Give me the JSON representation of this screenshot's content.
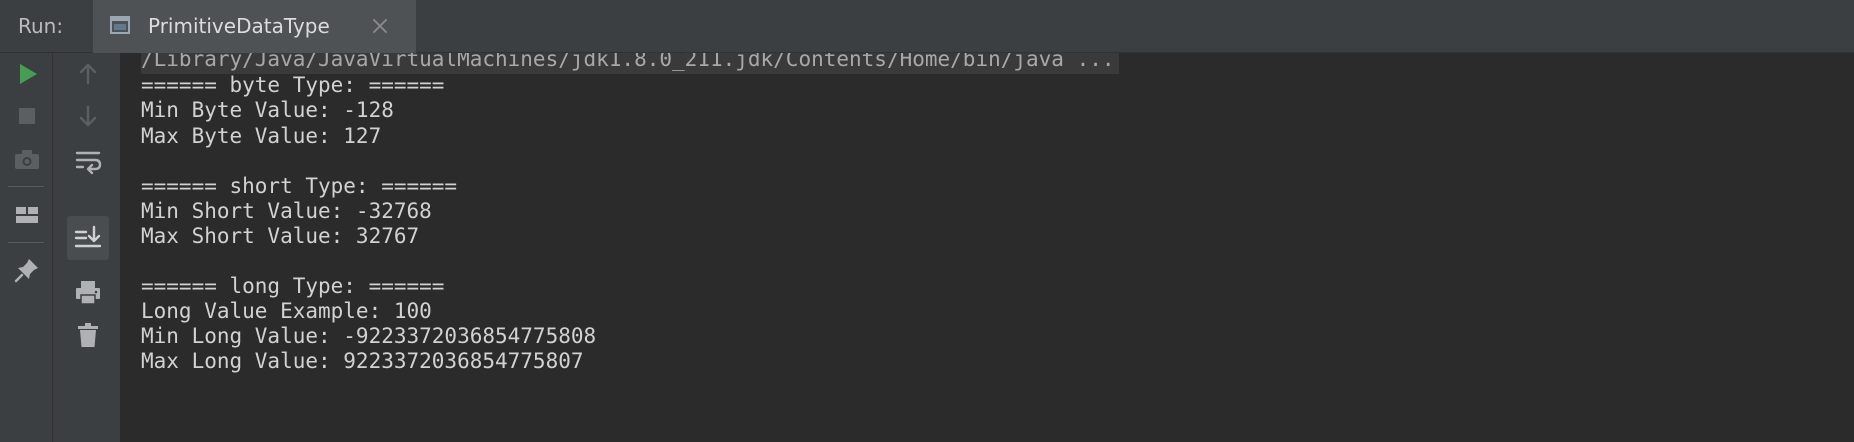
{
  "run_panel": {
    "label": "Run:",
    "tab": {
      "title": "PrimitiveDataType",
      "icon": "console-window-icon"
    }
  },
  "toolbar": {
    "left_icons": [
      "run-icon",
      "stop-icon",
      "camera-icon",
      "layout-icon",
      "pin-icon"
    ],
    "right_icons": [
      "up-arrow-icon",
      "down-arrow-icon",
      "soft-wrap-icon",
      "scroll-to-end-icon",
      "print-icon",
      "trash-icon"
    ]
  },
  "colors": {
    "run_green": "#499c54",
    "panel_bg": "#3c3f41",
    "console_bg": "#2b2b2b",
    "text": "#d2d2d2"
  },
  "console": {
    "lines": [
      "/Library/Java/JavaVirtualMachines/jdk1.8.0_211.jdk/Contents/Home/bin/java ...",
      "====== byte Type: ======",
      "Min Byte Value: -128",
      "Max Byte Value: 127",
      "",
      "====== short Type: ======",
      "Min Short Value: -32768",
      "Max Short Value: 32767",
      "",
      "====== long Type: ======",
      "Long Value Example: 100",
      "Min Long Value: -9223372036854775808",
      "Max Long Value: 9223372036854775807"
    ]
  }
}
